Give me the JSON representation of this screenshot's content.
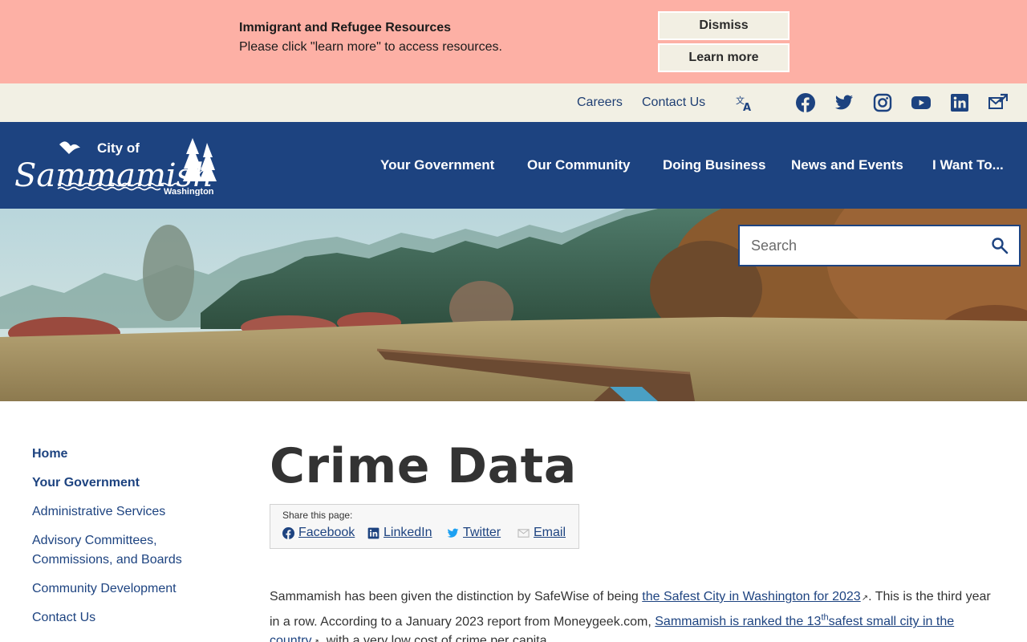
{
  "alert": {
    "title": "Immigrant and Refugee Resources",
    "text": "Please click \"learn more\" to access resources.",
    "dismiss_label": "Dismiss",
    "learn_more_label": "Learn more"
  },
  "utility": {
    "careers": "Careers",
    "contact": "Contact Us",
    "icons": [
      "translate-icon",
      "facebook-icon",
      "twitter-icon",
      "instagram-icon",
      "youtube-icon",
      "linkedin-icon",
      "email-subscribe-icon"
    ]
  },
  "logo": {
    "line1": "City of",
    "line2": "Sammamish",
    "line3": "Washington"
  },
  "nav": {
    "items": [
      "Your Government",
      "Our Community",
      "Doing Business",
      "News and Events",
      "I Want To..."
    ]
  },
  "search": {
    "placeholder": "Search"
  },
  "sidenav": {
    "items": [
      "Home",
      "Your Government",
      "Administrative Services",
      "Advisory Committees,",
      "Commissions, and Boards",
      "Community Development",
      "Contact Us"
    ]
  },
  "page": {
    "title": "Crime Data"
  },
  "share": {
    "label": "Share this page:",
    "facebook": "Facebook",
    "linkedin": "LinkedIn",
    "twitter": "Twitter",
    "email": "Email"
  },
  "content": {
    "p1_a": "Sammamish has been given the distinction by SafeWise of being ",
    "link1": "the Safest City in Washington for 2023",
    "p1_b": ". This is the third year in a row. According to a January 2023 report from Moneygeek.com, ",
    "link2_a": "Sammamish is ranked the 13",
    "link2_sup": "th",
    "link2_b": "safest small city in the country",
    "p1_c": ", with a very low cost of crime per capita."
  },
  "colors": {
    "alert_bg": "#fdb0a5",
    "utility_bg": "#f2f0e4",
    "nav_bg": "#1d4380",
    "link": "#1d4380"
  }
}
